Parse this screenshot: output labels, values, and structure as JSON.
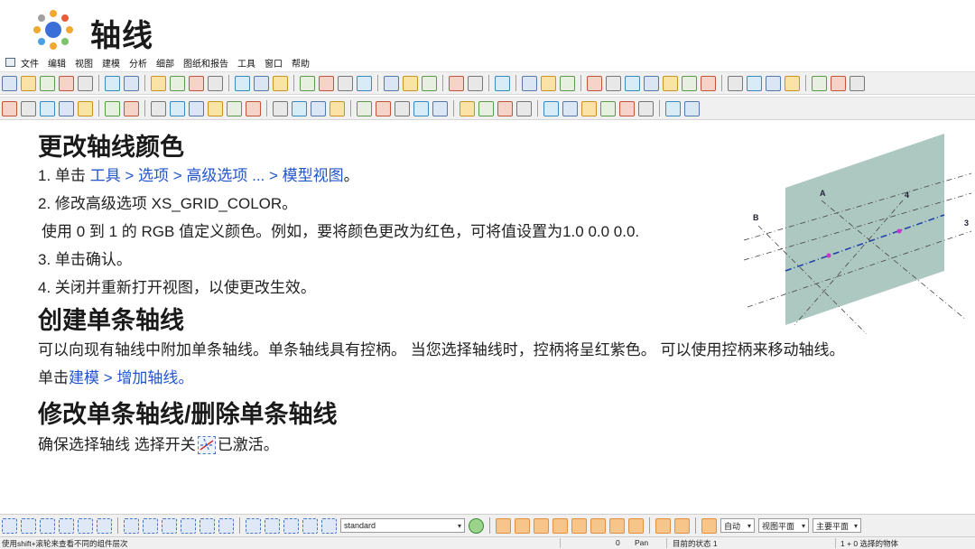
{
  "title": "轴线",
  "menu": [
    "文件",
    "编辑",
    "视图",
    "建模",
    "分析",
    "细部",
    "图纸和报告",
    "工具",
    "窗口",
    "帮助"
  ],
  "colors": {
    "link": "#2255cc",
    "plane": "#a9c4be",
    "accent_orange": "#f7c48a"
  },
  "section_color": {
    "heading": "更改轴线颜色",
    "step1_prefix": "1. 单击 ",
    "step1_path": "工具 > 选项 > 高级选项 ... > 模型视图",
    "step1_suffix": "。",
    "step2": "2. 修改高级选项 XS_GRID_COLOR。",
    "step2_detail": "使用 0 到 1 的 RGB 值定义颜色。例如，要将颜色更改为红色，可将值设置为1.0 0.0 0.0.",
    "step3": "3. 单击确认。",
    "step4": "4. 关闭并重新打开视图，以使更改生效。"
  },
  "section_create": {
    "heading": "创建单条轴线",
    "text": "可以向现有轴线中附加单条轴线。单条轴线具有控柄。 当您选择轴线时，控柄将呈红紫色。 可以使用控柄来移动轴线。",
    "step_prefix": "单击",
    "step_path": "建模 > 增加轴线。"
  },
  "section_modify": {
    "heading": "修改单条轴线/删除单条轴线",
    "text_before": "确保选择轴线 选择开关",
    "text_after": "已激活。"
  },
  "diagram": {
    "labels": [
      "A",
      "B",
      "4",
      "3"
    ]
  },
  "bottom_toolbar": {
    "standard_select": "standard",
    "auto_select": "自动",
    "view_plane_select": "视图平面",
    "main_plane_select": "主要平面"
  },
  "statusbar": {
    "hint": "使用shift+滚轮来查看不同的组件层次",
    "zero": "0",
    "mode": "Pan",
    "current_state": "目前的状态 1",
    "selected": "1 + 0 选择的物体"
  }
}
